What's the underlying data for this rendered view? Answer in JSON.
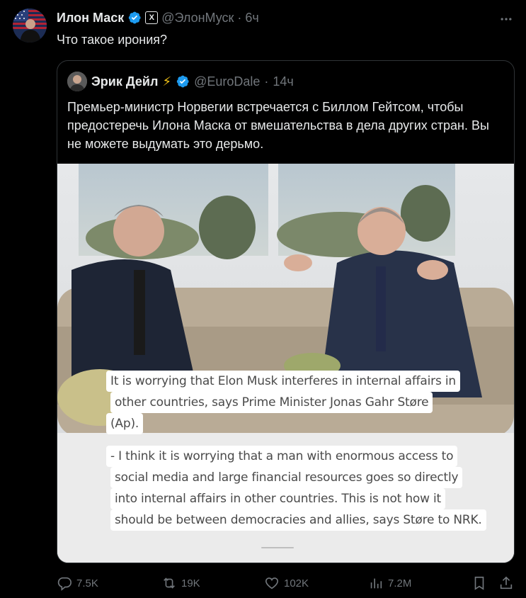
{
  "tweet": {
    "author": {
      "name": "Илон Маск",
      "handle": "@ЭлонМуск",
      "separator": "·",
      "time": "6ч",
      "badge_text": "X"
    },
    "text": "Что такое ирония?",
    "quote": {
      "author": {
        "name": "Эрик Дейл",
        "bolt": "⚡",
        "handle": "@EuroDale",
        "separator": "·",
        "time": "14ч"
      },
      "text": "Премьер-министр Норвегии встречается с Биллом Гейтсом, чтобы предостеречь Илона Маска от вмешательства в дела других стран. Вы не можете выдумать это дерьмо.",
      "image_caption_lines": [
        "It is worrying that Elon Musk interferes in internal affairs in",
        "other countries, says Prime Minister Jonas Gahr Støre",
        "(Ap).",
        "- I think it is worrying that a man with enormous access to",
        "social media and large financial resources goes so directly",
        "into internal affairs in other countries. This is not how it",
        "should be between democracies and allies, says Støre to NRK."
      ]
    },
    "actions": {
      "replies": "7.5K",
      "reposts": "19K",
      "likes": "102K",
      "views": "7.2M"
    }
  },
  "colors": {
    "background": "#000000",
    "text": "#e7e9ea",
    "muted": "#71767b",
    "verified": "#1d9bf0",
    "border": "#2f3336"
  },
  "icons": [
    "verified-icon",
    "x-logo-icon",
    "more-icon",
    "reply-icon",
    "repost-icon",
    "like-icon",
    "views-icon",
    "bookmark-icon",
    "share-icon"
  ]
}
